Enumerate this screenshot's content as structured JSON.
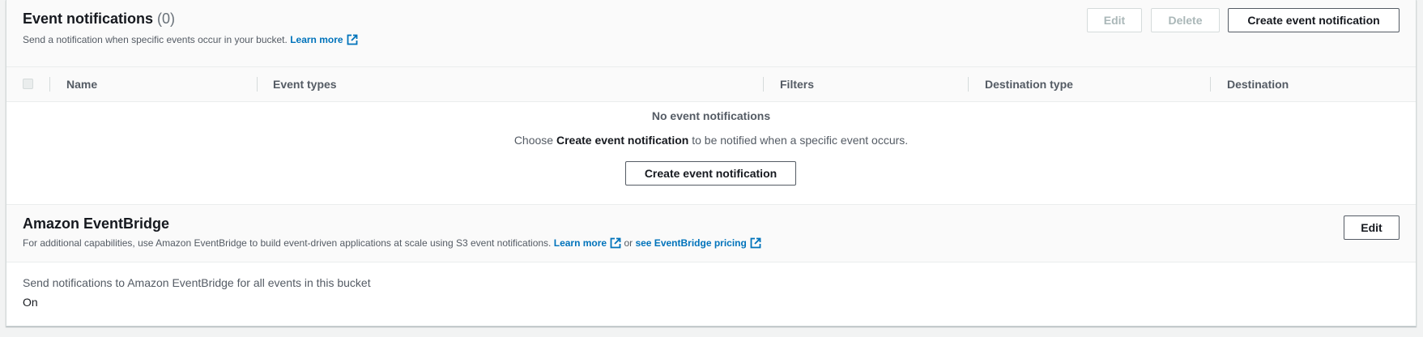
{
  "event_notifications": {
    "title": "Event notifications",
    "count": "(0)",
    "description": "Send a notification when specific events occur in your bucket.",
    "learn_more": "Learn more",
    "buttons": {
      "edit": "Edit",
      "delete": "Delete",
      "create": "Create event notification"
    },
    "columns": [
      "Name",
      "Event types",
      "Filters",
      "Destination type",
      "Destination"
    ],
    "empty_state": {
      "title": "No event notifications",
      "text_prefix": "Choose",
      "text_bold": "Create event notification",
      "text_suffix": "to be notified when a specific event occurs.",
      "button": "Create event notification"
    }
  },
  "eventbridge": {
    "title": "Amazon EventBridge",
    "description": "For additional capabilities, use Amazon EventBridge to build event-driven applications at scale using S3 event notifications.",
    "learn_more": "Learn more",
    "or_text": "or",
    "pricing_link": "see EventBridge pricing",
    "edit_button": "Edit",
    "setting_label": "Send notifications to Amazon EventBridge for all events in this bucket",
    "setting_value": "On"
  },
  "colors": {
    "link": "#0073bb",
    "text_primary": "#16191f",
    "text_secondary": "#545b64",
    "disabled": "#aab7b8"
  },
  "icons": [
    "external-link-icon",
    "checkbox"
  ]
}
